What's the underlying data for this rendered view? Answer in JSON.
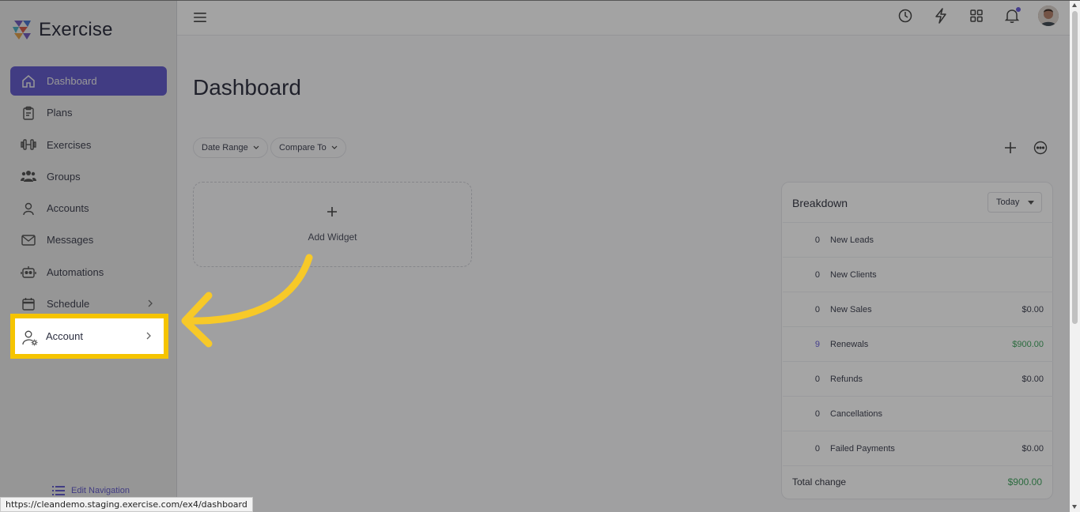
{
  "app": {
    "name": "Exercise"
  },
  "sidebar": {
    "items": [
      {
        "label": "Dashboard",
        "icon": "home-icon"
      },
      {
        "label": "Plans",
        "icon": "clipboard-icon"
      },
      {
        "label": "Exercises",
        "icon": "dumbbell-icon"
      },
      {
        "label": "Groups",
        "icon": "users-icon"
      },
      {
        "label": "Accounts",
        "icon": "user-icon"
      },
      {
        "label": "Messages",
        "icon": "mail-icon"
      },
      {
        "label": "Automations",
        "icon": "robot-icon"
      },
      {
        "label": "Schedule",
        "icon": "calendar-icon"
      },
      {
        "label": "Account",
        "icon": "user-settings-icon"
      }
    ],
    "edit_navigation": "Edit Navigation"
  },
  "page": {
    "title": "Dashboard"
  },
  "filters": {
    "date_range": "Date Range",
    "compare_to": "Compare To"
  },
  "widget": {
    "add_label": "Add Widget"
  },
  "breakdown": {
    "title": "Breakdown",
    "period": "Today",
    "rows": [
      {
        "count": "0",
        "label": "New Leads",
        "amount": ""
      },
      {
        "count": "0",
        "label": "New Clients",
        "amount": ""
      },
      {
        "count": "0",
        "label": "New Sales",
        "amount": "$0.00"
      },
      {
        "count": "9",
        "label": "Renewals",
        "amount": "$900.00"
      },
      {
        "count": "0",
        "label": "Refunds",
        "amount": "$0.00"
      },
      {
        "count": "0",
        "label": "Cancellations",
        "amount": ""
      },
      {
        "count": "0",
        "label": "Failed Payments",
        "amount": "$0.00"
      }
    ],
    "total_label": "Total change",
    "total_amount": "$900.00"
  },
  "status_url": "https://cleandemo.staging.exercise.com/ex4/dashboard",
  "colors": {
    "accent": "#5a4fd6",
    "highlight": "#f5c400",
    "positive": "#2e9b4f"
  }
}
